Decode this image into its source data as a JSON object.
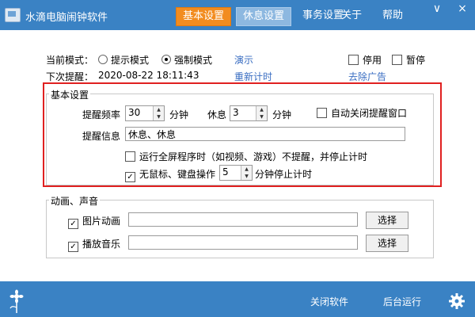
{
  "title_bar": {
    "app_title": "水滴电脑闹钟软件",
    "tabs": [
      {
        "label": "基本设置",
        "state": "active"
      },
      {
        "label": "休息设置",
        "state": "hover"
      },
      {
        "label": "事务设置",
        "state": "normal"
      },
      {
        "label": "关于",
        "state": "normal"
      },
      {
        "label": "帮助",
        "state": "normal"
      }
    ],
    "minimize": "∨",
    "close": "×"
  },
  "status": {
    "mode_label": "当前模式：",
    "mode_options": [
      "提示模式",
      "强制模式"
    ],
    "mode_selected": "强制模式",
    "demo_link": "演示",
    "stop_label": "停用",
    "pause_label": "暂停",
    "next_label": "下次提醒：",
    "next_time": "2020-08-22 18:11:43",
    "reset_link": "重新计时",
    "remove_ad_link": "去除广告"
  },
  "basic": {
    "group_title": "基本设置",
    "freq_label": "提醒频率",
    "freq_value": "30",
    "freq_unit": "分钟",
    "rest_label": "休息",
    "rest_value": "3",
    "rest_unit": "分钟",
    "auto_close_label": "自动关闭提醒窗口",
    "auto_close_checked": false,
    "info_label": "提醒信息",
    "info_value": "休息、休息",
    "fullscreen_label": "运行全屏程序时（如视频、游戏）不提醒，并停止计时",
    "fullscreen_checked": false,
    "idle_label": "无鼠标、键盘操作",
    "idle_value": "5",
    "idle_suffix": "分钟停止计时",
    "idle_checked": true
  },
  "media": {
    "group_title": "动画、声音",
    "image_label": "图片动画",
    "image_checked": true,
    "image_path": "",
    "music_label": "播放音乐",
    "music_checked": true,
    "music_path": "",
    "choose_label": "选择"
  },
  "footer": {
    "close_app": "关闭软件",
    "run_background": "后台运行"
  },
  "colors": {
    "title_bar": "#3a82c4",
    "active_tab": "#f28c1f",
    "highlight_frame": "#e02020",
    "link": "#3a6ec2"
  },
  "icons": [
    "app-icon",
    "checkmark-icon",
    "spin-arrows-icon",
    "flower-icon",
    "gear-icon"
  ]
}
